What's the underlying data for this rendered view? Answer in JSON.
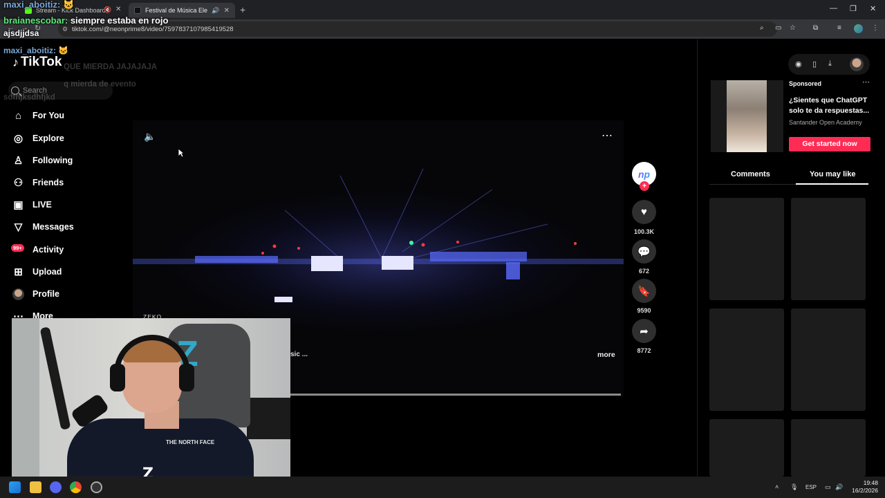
{
  "browser": {
    "tabs": [
      {
        "title": "Stream - Kick Dashboard",
        "favicon_color": "#53fc18"
      },
      {
        "title": "Festival de Música Eletrônic",
        "favicon_color": "#111111"
      }
    ],
    "url": "tiktok.com/@neonprime8/video/7597837107985419528"
  },
  "chat": [
    {
      "user": "maxi_aboitiz:",
      "text": "",
      "user_color": "#7aa7d8"
    },
    {
      "user": "braianescobar:",
      "text": "siempre estaba en rojo",
      "user_color": "#5ee87c"
    },
    {
      "user": "",
      "text": "ajsdjjdsa",
      "user_color": "#ffffff"
    },
    {
      "user": "maxi_aboitiz:",
      "text": "",
      "user_color": "#7aa7d8"
    },
    {
      "user": "",
      "text": "QUE MIERDA JAJAJAJA"
    },
    {
      "user": "",
      "text": "q mierda de evento"
    },
    {
      "user": "",
      "text": "sdfhjksdhfjkd"
    }
  ],
  "tiktok": {
    "logo": "TikTok",
    "search_placeholder": "Search",
    "nav": [
      {
        "label": "For You",
        "icon": "home-icon"
      },
      {
        "label": "Explore",
        "icon": "compass-icon"
      },
      {
        "label": "Following",
        "icon": "following-icon"
      },
      {
        "label": "Friends",
        "icon": "friends-icon"
      },
      {
        "label": "LIVE",
        "icon": "live-icon"
      },
      {
        "label": "Messages",
        "icon": "messages-icon"
      },
      {
        "label": "Activity",
        "icon": "activity-icon",
        "badge": "99+"
      },
      {
        "label": "Upload",
        "icon": "upload-icon"
      },
      {
        "label": "Profile",
        "icon": "avatar"
      },
      {
        "label": "More",
        "icon": "more-icon"
      }
    ]
  },
  "video": {
    "watermark": "ZEKO",
    "description_tail": "sic ...",
    "more_label": "more",
    "creator_initials": "np",
    "actions": [
      {
        "name": "like",
        "icon": "heart-icon",
        "count": "100.3K"
      },
      {
        "name": "comment",
        "icon": "comment-icon",
        "count": "672"
      },
      {
        "name": "save",
        "icon": "bookmark-icon",
        "count": "9590"
      },
      {
        "name": "share",
        "icon": "share-icon",
        "count": "8772"
      }
    ]
  },
  "right_panel": {
    "ad": {
      "sponsored_label": "Sponsored",
      "title": "¿Sientes que ChatGPT solo te da respuestas...",
      "brand": "Santander Open Academy",
      "cta": "Get started now"
    },
    "tabs": [
      "Comments",
      "You may like"
    ],
    "active_tab": "You may like"
  },
  "webcam": {
    "logo": "Z",
    "shirt_logo": "THE NORTH FACE"
  },
  "taskbar": {
    "language": "ESP",
    "time": "19:48",
    "date": "16/2/2026"
  },
  "colors": {
    "accent": "#fe2c55",
    "kick_green": "#53fc18"
  }
}
